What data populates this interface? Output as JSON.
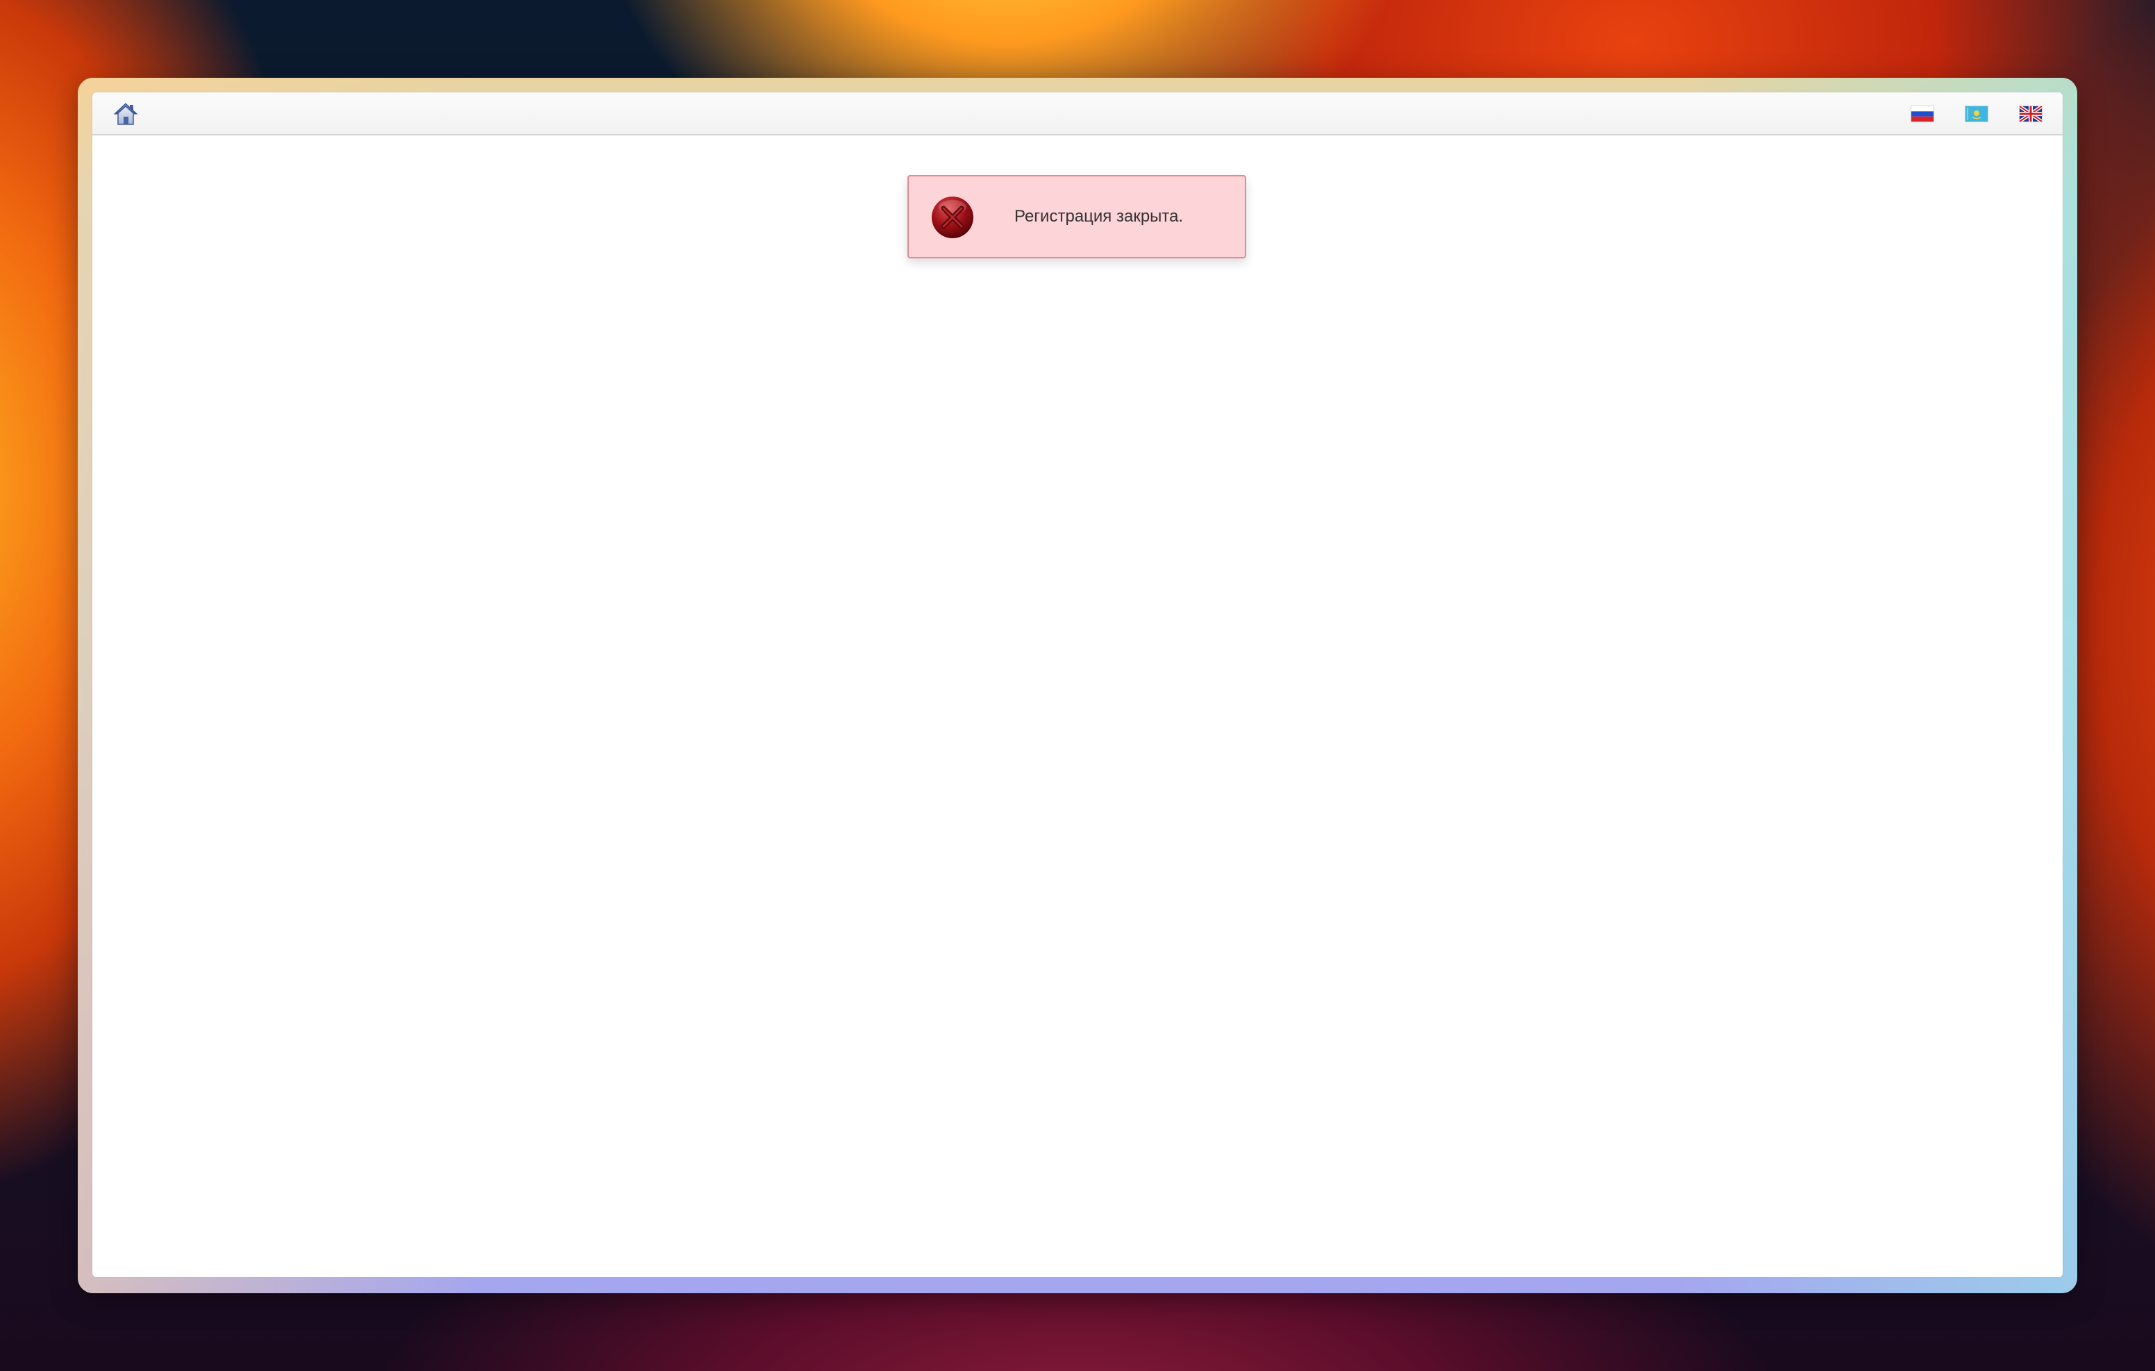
{
  "header": {
    "home_icon": "home-icon",
    "languages": [
      {
        "code": "ru",
        "icon": "flag-russia-icon"
      },
      {
        "code": "kz",
        "icon": "flag-kazakhstan-icon"
      },
      {
        "code": "en",
        "icon": "flag-uk-icon"
      }
    ]
  },
  "alert": {
    "type": "error",
    "icon": "error-icon",
    "message": "Регистрация закрыта."
  },
  "colors": {
    "alert_background": "#fdd4d7",
    "alert_border": "#e08a92",
    "error_icon": "#8e0d12"
  }
}
